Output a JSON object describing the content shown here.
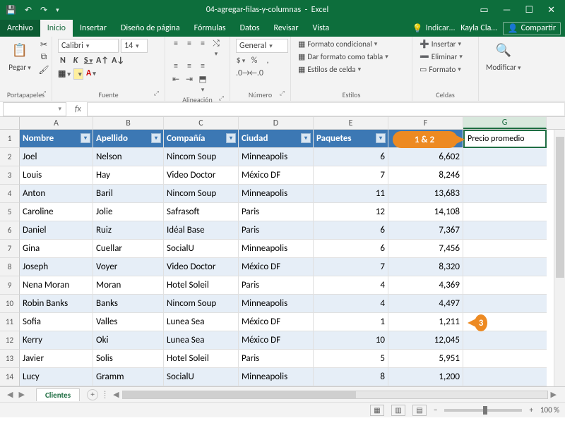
{
  "titlebar": {
    "doc": "04-agregar-filas-y-columnas",
    "app": "Excel"
  },
  "winbtns": {
    "ribbonopts": "▭",
    "min": "—",
    "max": "☐",
    "close": "✕"
  },
  "tabs": {
    "file": "Archivo",
    "items": [
      "Inicio",
      "Insertar",
      "Diseño de página",
      "Fórmulas",
      "Datos",
      "Revisar",
      "Vista"
    ],
    "tell": "Indicar…",
    "user": "Kayla Cla…",
    "share": "Compartir"
  },
  "ribbon": {
    "clipboard": {
      "paste": "Pegar",
      "name": "Portapapeles"
    },
    "font": {
      "name_field": "Calibri",
      "size_field": "14",
      "group": "Fuente"
    },
    "align": {
      "wrap": "Ajustar",
      "merge": "Combinar",
      "group": "Alineación"
    },
    "number": {
      "format": "General",
      "group": "Número"
    },
    "styles": {
      "cond": "Formato condicional",
      "table": "Dar formato como tabla",
      "cells": "Estilos de celda",
      "group": "Estilos"
    },
    "cells_g": {
      "insert": "Insertar",
      "delete": "Eliminar",
      "format": "Formato",
      "group": "Celdas"
    },
    "editing": {
      "btn": "Modificar"
    }
  },
  "fx": {
    "name": "",
    "label": "fx"
  },
  "columns": [
    "A",
    "B",
    "C",
    "D",
    "E",
    "F",
    "G"
  ],
  "headers": [
    "Nombre",
    "Apellido",
    "Compañía",
    "Ciudad",
    "Paquetes"
  ],
  "g_header": "Precio promedio",
  "rows": [
    {
      "n": "2",
      "a": "Joel",
      "b": "Nelson",
      "c": "Nincom Soup",
      "d": "Minneapolis",
      "e": "6",
      "f": "6,602"
    },
    {
      "n": "3",
      "a": "Louis",
      "b": "Hay",
      "c": "Video Doctor",
      "d": "México DF",
      "e": "7",
      "f": "8,246"
    },
    {
      "n": "4",
      "a": "Anton",
      "b": "Baril",
      "c": "Nincom Soup",
      "d": "Minneapolis",
      "e": "11",
      "f": "13,683"
    },
    {
      "n": "5",
      "a": "Caroline",
      "b": "Jolie",
      "c": "Safrasoft",
      "d": "Paris",
      "e": "12",
      "f": "14,108"
    },
    {
      "n": "6",
      "a": "Daniel",
      "b": "Ruiz",
      "c": "Idéal Base",
      "d": "Paris",
      "e": "6",
      "f": "7,367"
    },
    {
      "n": "7",
      "a": "Gina",
      "b": "Cuellar",
      "c": "SocialU",
      "d": "Minneapolis",
      "e": "6",
      "f": "7,456"
    },
    {
      "n": "8",
      "a": "Joseph",
      "b": "Voyer",
      "c": "Video Doctor",
      "d": "México DF",
      "e": "7",
      "f": "8,320"
    },
    {
      "n": "9",
      "a": "Nena Moran",
      "b": "Moran",
      "c": "Hotel Soleil",
      "d": "Paris",
      "e": "4",
      "f": "4,369"
    },
    {
      "n": "10",
      "a": "Robin Banks",
      "b": "Banks",
      "c": "Nincom Soup",
      "d": "Minneapolis",
      "e": "4",
      "f": "4,497"
    },
    {
      "n": "11",
      "a": "Sofia",
      "b": "Valles",
      "c": "Lunea Sea",
      "d": "México DF",
      "e": "1",
      "f": "1,211"
    },
    {
      "n": "12",
      "a": "Kerry",
      "b": "Oki",
      "c": "Lunea Sea",
      "d": "México DF",
      "e": "10",
      "f": "12,045"
    },
    {
      "n": "13",
      "a": "Javier",
      "b": "Solis",
      "c": "Hotel Soleil",
      "d": "Paris",
      "e": "5",
      "f": "5,951"
    },
    {
      "n": "14",
      "a": "Lucy",
      "b": "Gramm",
      "c": "SocialU",
      "d": "Minneapolis",
      "e": "8",
      "f": "1,200"
    }
  ],
  "callouts": {
    "c1": "1 & 2",
    "c2": "3"
  },
  "sheet": {
    "name": "Clientes",
    "add": "+"
  },
  "status": {
    "zoom": "100 %",
    "minus": "−",
    "plus": "+"
  }
}
